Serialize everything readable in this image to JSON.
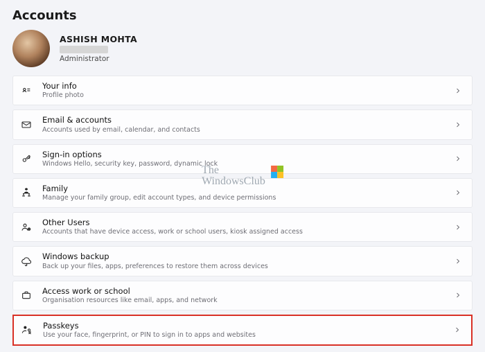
{
  "page": {
    "title": "Accounts"
  },
  "profile": {
    "name": "ASHISH MOHTA",
    "role": "Administrator"
  },
  "watermark": {
    "line1": "The",
    "line2": "WindowsClub"
  },
  "items": [
    {
      "icon": "person-card-icon",
      "title": "Your info",
      "subtitle": "Profile photo"
    },
    {
      "icon": "email-icon",
      "title": "Email & accounts",
      "subtitle": "Accounts used by email, calendar, and contacts"
    },
    {
      "icon": "key-icon",
      "title": "Sign-in options",
      "subtitle": "Windows Hello, security key, password, dynamic lock"
    },
    {
      "icon": "family-icon",
      "title": "Family",
      "subtitle": "Manage your family group, edit account types, and device permissions"
    },
    {
      "icon": "other-users-icon",
      "title": "Other Users",
      "subtitle": "Accounts that have device access, work or school users, kiosk assigned access"
    },
    {
      "icon": "backup-icon",
      "title": "Windows backup",
      "subtitle": "Back up your files, apps, preferences to restore them across devices"
    },
    {
      "icon": "briefcase-icon",
      "title": "Access work or school",
      "subtitle": "Organisation resources like email, apps, and network"
    },
    {
      "icon": "passkey-icon",
      "title": "Passkeys",
      "subtitle": "Use your face, fingerprint, or PIN to sign in to apps and websites"
    }
  ]
}
